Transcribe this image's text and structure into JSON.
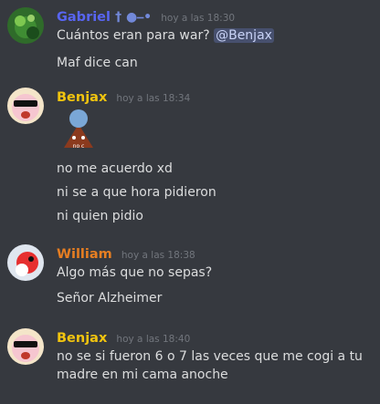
{
  "messages": [
    {
      "author": "Gabriel",
      "author_badge": "† ●⎯•",
      "author_color": "#5865f2",
      "timestamp": "hoy a las 18:30",
      "lines": [
        "Cuántos eran para war?",
        "Maf dice can"
      ],
      "mention": "@Benjax"
    },
    {
      "author": "Benjax",
      "author_color": "#f1c40f",
      "timestamp": "hoy a las 18:34",
      "emote_caption": "no c",
      "lines": [
        "no me acuerdo xd",
        "ni se a que hora pidieron",
        "ni quien pidio"
      ]
    },
    {
      "author": "William",
      "author_color": "#e67e22",
      "timestamp": "hoy a las 18:38",
      "lines": [
        "Algo más que no sepas?",
        "Señor Alzheimer"
      ]
    },
    {
      "author": "Benjax",
      "author_color": "#f1c40f",
      "timestamp": "hoy a las 18:40",
      "lines": [
        "no se si fueron 6 o 7 las veces que me cogi a tu",
        "madre en mi cama anoche"
      ]
    }
  ]
}
